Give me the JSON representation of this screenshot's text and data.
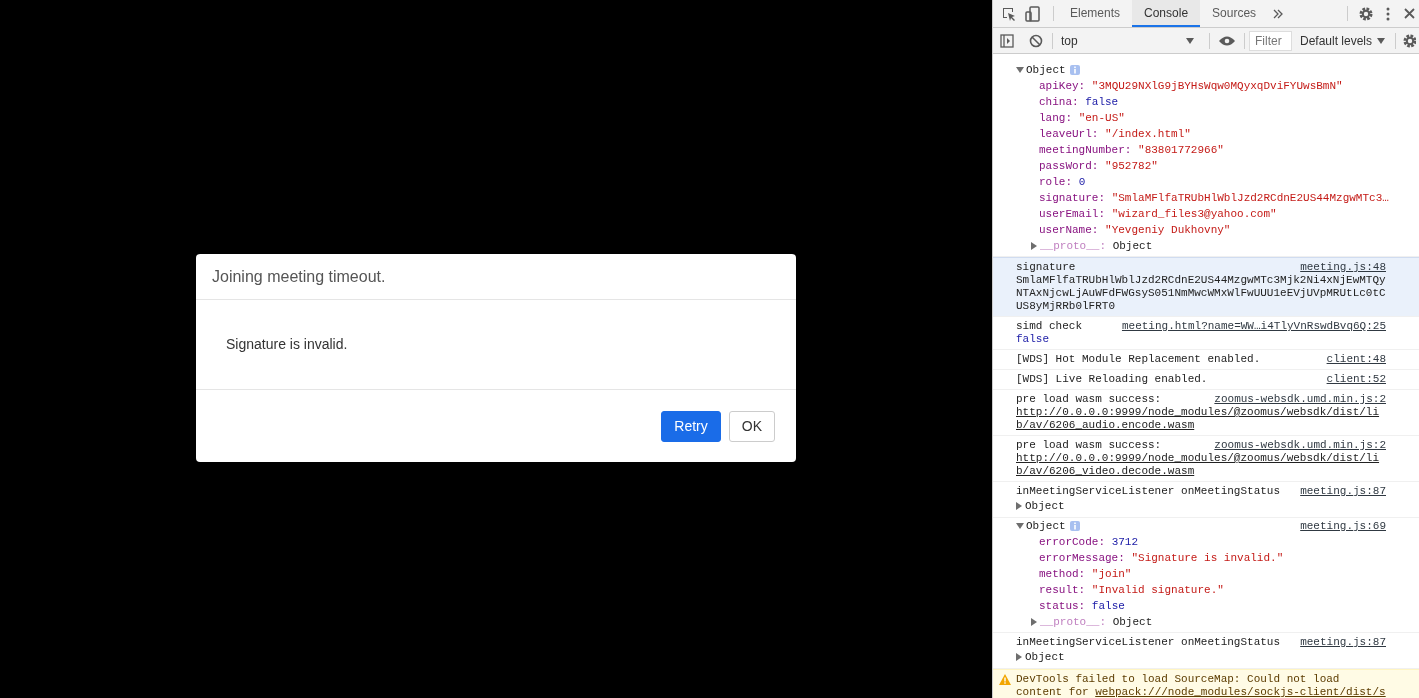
{
  "dialog": {
    "title": "Joining meeting timeout.",
    "message": "Signature is invalid.",
    "buttons": [
      {
        "label": "Retry",
        "kind": "primary"
      },
      {
        "label": "OK",
        "kind": "default"
      }
    ]
  },
  "devtools": {
    "tabs": [
      {
        "label": "Elements",
        "selected": false
      },
      {
        "label": "Console",
        "selected": true
      },
      {
        "label": "Sources",
        "selected": false
      }
    ],
    "context": "top",
    "filter_placeholder": "Filter",
    "levels": "Default levels",
    "messages": [
      {
        "kind": "object",
        "label": "Object",
        "expanded": true,
        "properties": [
          {
            "key": "apiKey:",
            "value": "\"3MQU29NXlG9jBYHsWqw0MQyxqDviFYUwsBmN\"",
            "kind": "string"
          },
          {
            "key": "china:",
            "value": "false",
            "kind": "boolean"
          },
          {
            "key": "lang:",
            "value": "\"en-US\"",
            "kind": "string"
          },
          {
            "key": "leaveUrl:",
            "value": "\"/index.html\"",
            "kind": "string"
          },
          {
            "key": "meetingNumber:",
            "value": "\"83801772966\"",
            "kind": "string"
          },
          {
            "key": "passWord:",
            "value": "\"952782\"",
            "kind": "string"
          },
          {
            "key": "role:",
            "value": "0",
            "kind": "number"
          },
          {
            "key": "signature:",
            "value": "\"SmlaMFlfaTRUbHlWblJzd2RCdnE2US44MzgwMTc3…",
            "kind": "string"
          },
          {
            "key": "userEmail:",
            "value": "\"wizard_files3@yahoo.com\"",
            "kind": "string"
          },
          {
            "key": "userName:",
            "value": "\"Yevgeniy Dukhovny\"",
            "kind": "string"
          }
        ],
        "proto": {
          "key": "__proto__:",
          "value": "Object"
        }
      },
      {
        "kind": "log",
        "highlighted": true,
        "text": "signature",
        "source": "meeting.js:48",
        "detail": "SmlaMFlfaTRUbHlWblJzd2RCdnE2US44MzgwMTc3Mjk2Ni4xNjEwMTQyNTAxNjcwLjAuWFdFWGsyS051NmMwcWMxWlFwUUU1eEVjUVpMRUtLc0tCUS8yMjRRb0lFRT0"
      },
      {
        "kind": "log",
        "highlighted": false,
        "text": "simd check",
        "source": "meeting.html?name=WW…i4TlyVnRswdBvq6Q:25",
        "value": "false"
      },
      {
        "kind": "log",
        "highlighted": false,
        "text": "[WDS] Hot Module Replacement enabled.",
        "source": "client:48"
      },
      {
        "kind": "log",
        "highlighted": false,
        "text": "[WDS] Live Reloading enabled.",
        "source": "client:52"
      },
      {
        "kind": "log",
        "highlighted": false,
        "text": "pre load wasm success:",
        "link": "http://0.0.0.0:9999/node_modules/@zoomus/websdk/dist/lib/av/6206_audio.encode.wasm",
        "source": "zoomus-websdk.umd.min.js:2"
      },
      {
        "kind": "log",
        "highlighted": false,
        "text": "pre load wasm success:",
        "link": "http://0.0.0.0:9999/node_modules/@zoomus/websdk/dist/lib/av/6206_video.decode.wasm",
        "source": "zoomus-websdk.umd.min.js:2"
      },
      {
        "kind": "log",
        "highlighted": false,
        "text": "inMeetingServiceListener onMeetingStatus",
        "source": "meeting.js:87",
        "child": {
          "label": "Object",
          "expanded": false
        }
      },
      {
        "kind": "object",
        "label": "Object",
        "expanded": true,
        "source": "meeting.js:69",
        "properties": [
          {
            "key": "errorCode:",
            "value": "3712",
            "kind": "number"
          },
          {
            "key": "errorMessage:",
            "value": "\"Signature is invalid.\"",
            "kind": "string"
          },
          {
            "key": "method:",
            "value": "\"join\"",
            "kind": "string"
          },
          {
            "key": "result:",
            "value": "\"Invalid signature.\"",
            "kind": "string"
          },
          {
            "key": "status:",
            "value": "false",
            "kind": "boolean"
          }
        ],
        "proto": {
          "key": "__proto__:",
          "value": "Object"
        }
      },
      {
        "kind": "log",
        "highlighted": false,
        "text": "inMeetingServiceListener onMeetingStatus",
        "source": "meeting.js:87",
        "child": {
          "label": "Object",
          "expanded": false
        }
      },
      {
        "kind": "warning",
        "text": "DevTools failed to load SourceMap: Could not load content for",
        "link": "webpack:///node_modules/sockjs-client/dist/s"
      }
    ]
  }
}
